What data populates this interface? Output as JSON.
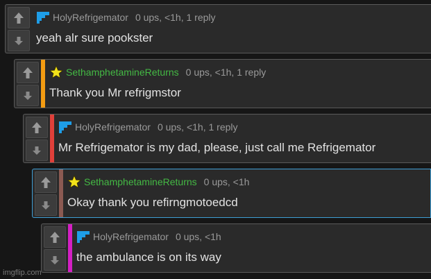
{
  "colors": {
    "background": "#161616",
    "panel": "#2a2a2a",
    "green_username": "#44b944",
    "blue_badge": "#1e9ee8",
    "star_badge": "#f2e21a",
    "bar_orange": "#f39c12",
    "bar_red": "#e0403a",
    "bar_brown": "#8b5a52",
    "bar_magenta": "#d41fc4",
    "highlight_border": "#3f9fd6"
  },
  "comments": [
    {
      "username": "HolyRefrigemator",
      "badge": "blue-staircase-icon",
      "stats": "0 ups, <1h, 1 reply",
      "text": "yeah alr sure pookster",
      "bar_color": ""
    },
    {
      "username": "SethamphetamineReturns",
      "badge": "star-icon",
      "stats": "0 ups, <1h, 1 reply",
      "text": "Thank you Mr refrigmstor",
      "bar_color": "#f39c12"
    },
    {
      "username": "HolyRefrigemator",
      "badge": "blue-staircase-icon",
      "stats": "0 ups, <1h, 1 reply",
      "text": "Mr Refrigemator is my dad, please, just call me Refrigemator",
      "bar_color": "#e0403a"
    },
    {
      "username": "SethamphetamineReturns",
      "badge": "star-icon",
      "stats": "0 ups, <1h",
      "text": "Okay thank you refirngmotoedcd",
      "bar_color": "#8b5a52"
    },
    {
      "username": "HolyRefrigemator",
      "badge": "blue-staircase-icon",
      "stats": "0 ups, <1h",
      "text": "the ambulance is on its way",
      "bar_color": "#d41fc4"
    }
  ],
  "watermark": "imgflip.com"
}
